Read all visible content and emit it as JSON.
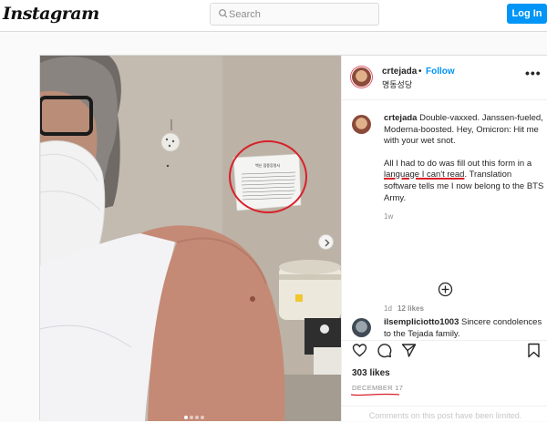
{
  "header": {
    "logo_text": "Instagram",
    "search": {
      "placeholder": "Search",
      "value": ""
    },
    "login_label": "Log In"
  },
  "post": {
    "author": {
      "username": "crtejada",
      "follow_label": "Follow",
      "separator": "•",
      "location": "명동성당"
    },
    "more_label": "•••",
    "photo": {
      "notice_title": "백신 접종증명서",
      "carousel_index": 1,
      "carousel_count": 4
    },
    "caption": {
      "username": "crtejada",
      "paragraph1": "Double-vaxxed. Janssen-fueled, Moderna-boosted. Hey, Omicron: Hit me with your wet snot.",
      "paragraph2_part1": "All I had to do was fill out this form in a ",
      "paragraph2_underlined": "language I can't read",
      "paragraph2_part2": ". Translation software tells me I now belong to the BTS Army.",
      "time": "1w"
    },
    "comment": {
      "username": "ilsemplicìotto1003",
      "text": "Sincere condolences to the Tejada family.",
      "time": "1d",
      "likes": "12 likes"
    },
    "likes_text": "303 likes",
    "date": "DECEMBER 17",
    "comments_limited": "Comments on this post have been limited."
  },
  "colors": {
    "accent": "#0095f6",
    "annotation_red": "#d8202a",
    "muted": "#8e8e8e"
  },
  "icons": [
    "search-icon",
    "chevron-right-icon",
    "more-icon",
    "add-circle-icon",
    "heart-icon",
    "comment-icon",
    "share-icon",
    "bookmark-icon"
  ]
}
